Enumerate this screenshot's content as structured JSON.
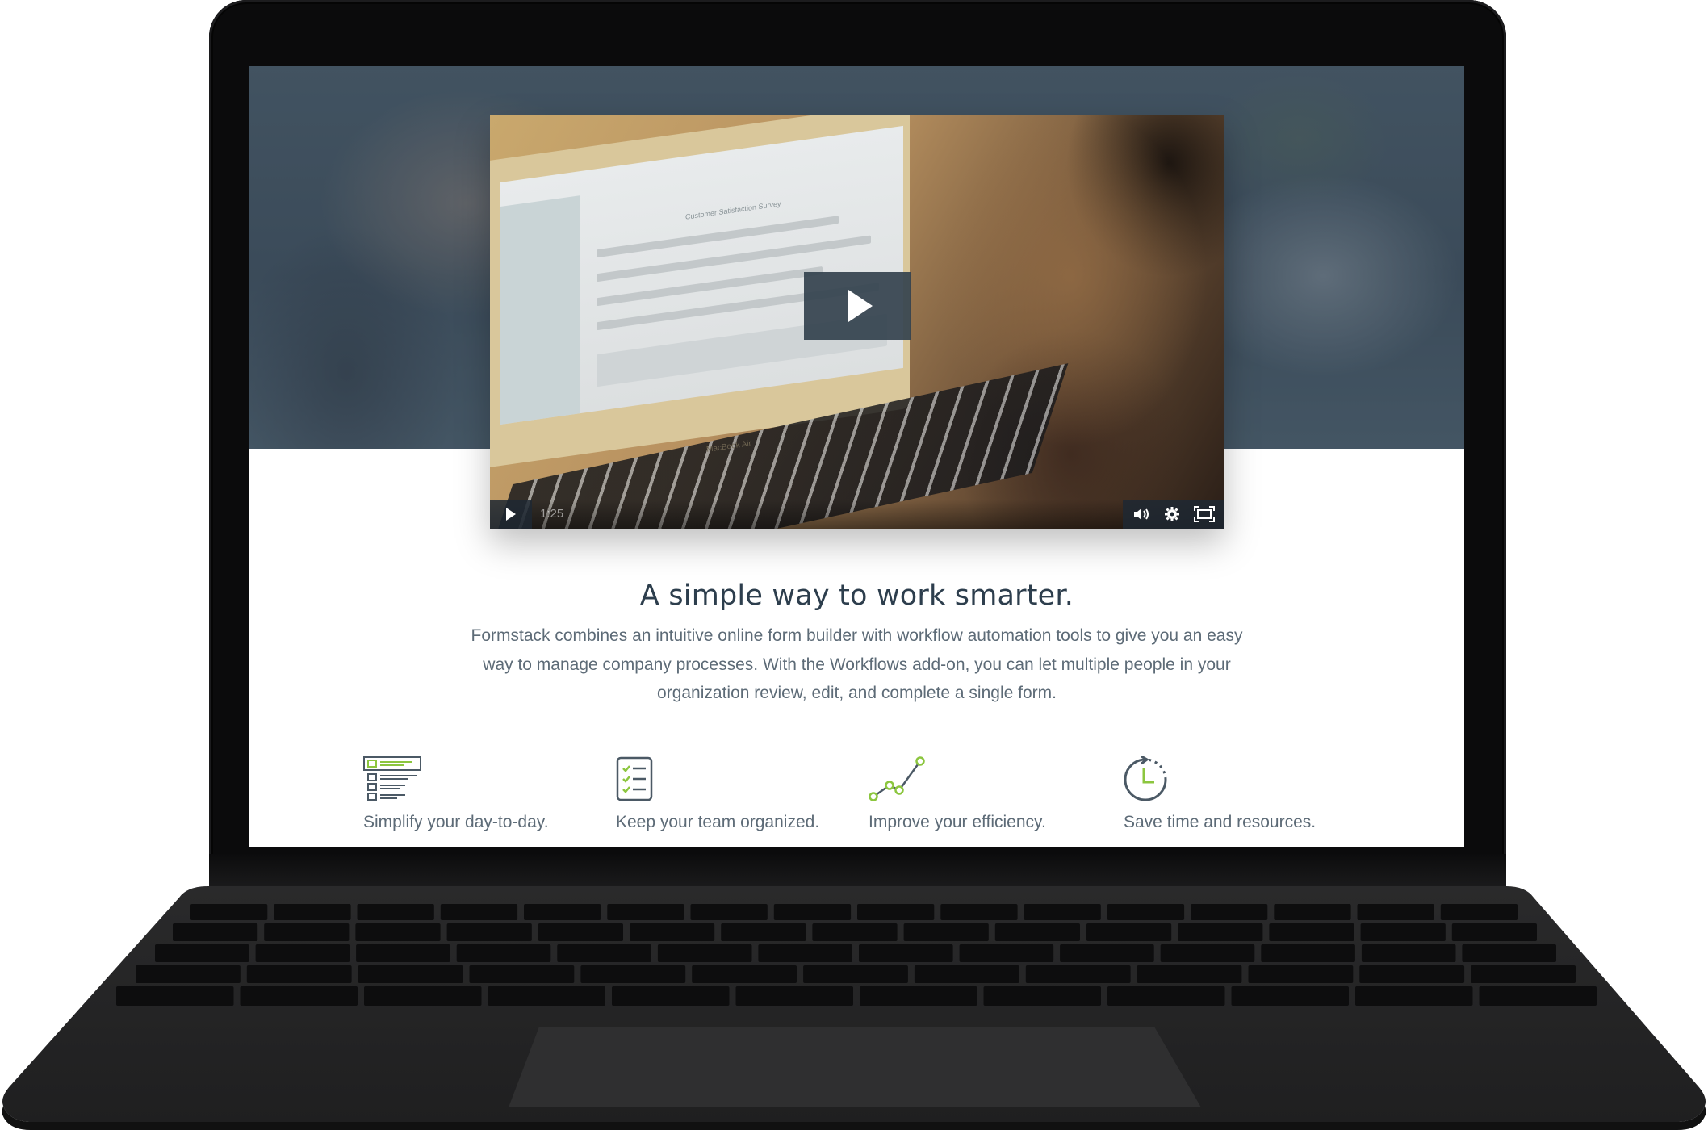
{
  "video": {
    "duration": "1:25",
    "in_video_title": "Customer Satisfaction Survey",
    "in_video_brand": "MacBook Air"
  },
  "content": {
    "headline": "A simple way to work smarter.",
    "description_lines": [
      "Formstack combines an intuitive online form builder with workflow automation tools to give you an easy",
      "way to manage company processes. With the Workflows add-on, you can let multiple people in your",
      "organization review, edit, and complete a single form."
    ]
  },
  "features": [
    {
      "icon": "form-builder-icon",
      "label": "Simplify your day-to-day."
    },
    {
      "icon": "checklist-icon",
      "label": "Keep your team organized."
    },
    {
      "icon": "trend-line-icon",
      "label": "Improve your efficiency."
    },
    {
      "icon": "clock-icon",
      "label": "Save time and resources."
    }
  ],
  "colors": {
    "accent_green": "#8cc63f",
    "icon_gray": "#4b5965",
    "text_dark": "#2d3e4d",
    "text_body": "#5d6b77"
  }
}
